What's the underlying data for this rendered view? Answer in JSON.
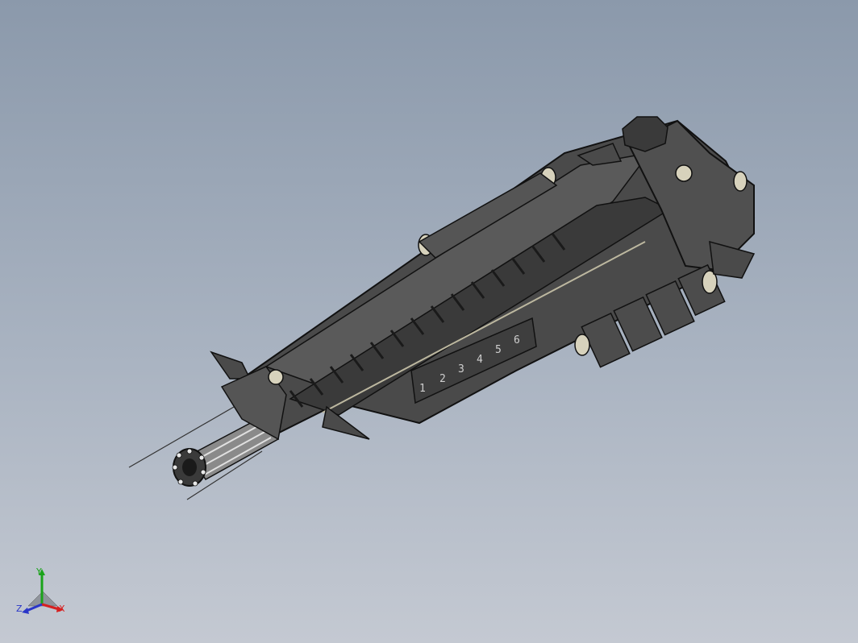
{
  "viewport": {
    "background_top": "#8b99ab",
    "background_bottom": "#c4c9d2"
  },
  "model": {
    "body_color": "#4a4a4a",
    "edge_color": "#111111",
    "accent_color": "#bdb8a0",
    "panel_numbers": [
      "1",
      "2",
      "3",
      "4",
      "5",
      "6"
    ]
  },
  "triad": {
    "x_label": "X",
    "y_label": "Y",
    "z_label": "Z",
    "x_color": "#d62020",
    "y_color": "#1aa31a",
    "z_color": "#2a36c8"
  }
}
